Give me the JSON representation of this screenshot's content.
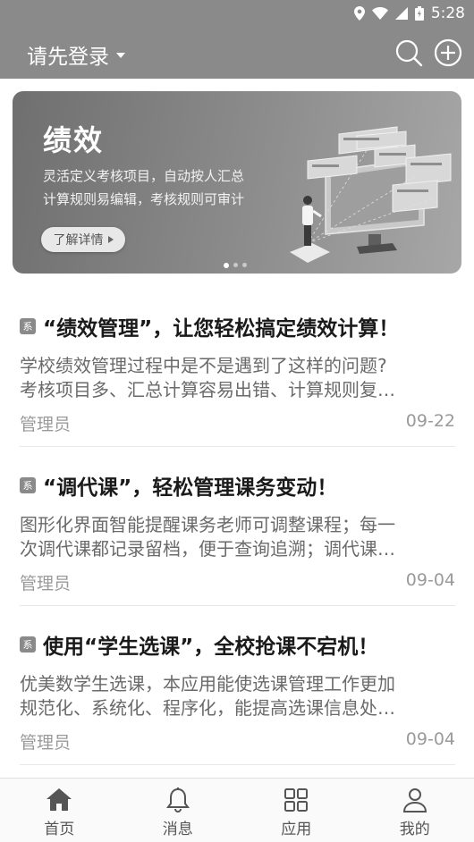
{
  "status_bar": {
    "time": "5:28"
  },
  "header": {
    "login_label": "请先登录"
  },
  "banner": {
    "title": "绩效",
    "desc_line1": "灵活定义考核项目，自动按人汇总",
    "desc_line2": "计算规则易编辑，考核规则可审计",
    "button_label": "了解详情"
  },
  "news": [
    {
      "badge": "系",
      "title": "“绩效管理”，让您轻松搞定绩效计算！",
      "summary_line1": "学校绩效管理过程中是不是遇到了这样的问题?",
      "summary_line2": "考核项目多、汇总计算容易出错、计算规则复…",
      "author": "管理员",
      "date": "09-22"
    },
    {
      "badge": "系",
      "title": "“调代课”，轻松管理课务变动！",
      "summary_line1": "图形化界面智能提醒课务老师可调整课程；每一",
      "summary_line2": "次调代课都记录留档，便于查询追溯；调代课…",
      "author": "管理员",
      "date": "09-04"
    },
    {
      "badge": "系",
      "title": "使用“学生选课”，全校抢课不宕机！",
      "summary_line1": "优美数学生选课，本应用能使选课管理工作更加",
      "summary_line2": "规范化、系统化、程序化，能提高选课信息处…",
      "author": "管理员",
      "date": "09-04"
    }
  ],
  "tabs": [
    {
      "label": "首页",
      "icon": "home-icon"
    },
    {
      "label": "消息",
      "icon": "bell-icon"
    },
    {
      "label": "应用",
      "icon": "apps-icon"
    },
    {
      "label": "我的",
      "icon": "user-icon"
    }
  ],
  "colors": {
    "header_bg": "#8a8a8a",
    "banner_bg": "#7d7d7d"
  }
}
